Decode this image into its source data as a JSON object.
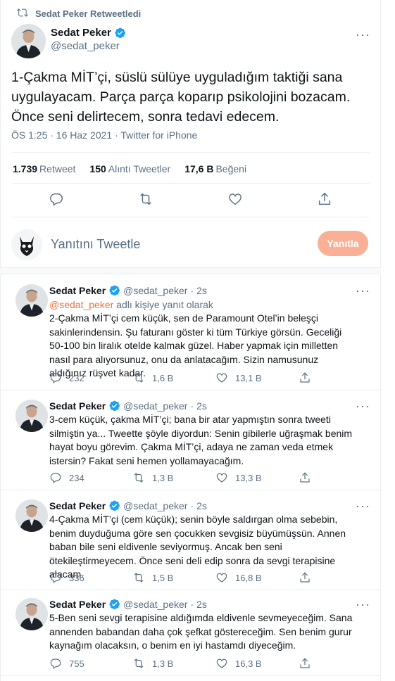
{
  "retweet_label": "Sedat Peker Retweetledi",
  "colors": {
    "accent": "#f4703a",
    "reply_button": "#f9b095",
    "muted": "#5b7083"
  },
  "main_tweet": {
    "name": "Sedat Peker",
    "handle": "@sedat_peker",
    "text": "1-Çakma MİT’çi, süslü sülüye uyguladığım taktiği sana uygulayacam. Parça parça koparıp psikolojini bozacam. Önce seni delirtecem, sonra tedavi edecem.",
    "time": "ÖS 1:25 · 16 Haz 2021 · ",
    "source": "Twitter for iPhone",
    "stats": [
      {
        "num": "1.739",
        "label": "Retweet"
      },
      {
        "num": "150",
        "label": "Alıntı Tweetler"
      },
      {
        "num": "17,6 B",
        "label": "Beğeni"
      }
    ]
  },
  "reply_box": {
    "placeholder": "Yanıtını Tweetle",
    "button": "Yanıtla"
  },
  "replies": [
    {
      "name": "Sedat Peker",
      "handle": "@sedat_peker",
      "dot": "·",
      "time": "2s",
      "reply_mention": "@sedat_peker",
      "reply_suffix": " adlı kişiye yanıt olarak",
      "text": "2-Çakma MİT’çi cem küçük, sen de Paramount Otel’in beleşçi sakinlerindensin.  Şu faturanı göster ki tüm Türkiye görsün. Geceliği 50-100 bin liralık otelde kalmak güzel. Haber yapmak için milletten nasıl para alıyorsunuz, onu da anlatacağım. Sizin namusunuz aldığınız rüşvet kadar.",
      "replies": "232",
      "retweets": "1,6 B",
      "likes": "13,1 B"
    },
    {
      "name": "Sedat Peker",
      "handle": "@sedat_peker",
      "dot": "·",
      "time": "2s",
      "text": "3-cem küçük, çakma MİT’çi; bana bir atar yapmıştın sonra tweeti silmiştin ya... Tweette şöyle diyordun: Senin gibilerle uğraşmak benim hayat boyu görevim. Çakma MİT’çi, adaya ne zaman veda etmek istersin? Fakat seni hemen yollamayacağım.",
      "replies": "234",
      "retweets": "1,3 B",
      "likes": "13,3 B"
    },
    {
      "name": "Sedat Peker",
      "handle": "@sedat_peker",
      "dot": "·",
      "time": "2s",
      "text": "4-Çakma MİT’çi (cem küçük); senin böyle saldırgan olma sebebin, benim duyduğuma göre sen çocukken sevgisiz büyümüşsün. Annen baban bile seni eldivenle seviyormuş. Ancak ben seni ötekileştirmeyecem. Önce seni deli edip sonra da sevgi terapisine alacam.",
      "replies": "336",
      "retweets": "1,5 B",
      "likes": "16,8 B"
    },
    {
      "name": "Sedat Peker",
      "handle": "@sedat_peker",
      "dot": "·",
      "time": "2s",
      "text": "5-Ben seni sevgi terapisine aldığımda eldivenle sevmeyeceğim. Sana annenden babandan daha çok şefkat göstereceğim. Sen benim gurur kaynağım olacaksın, o benim en iyi hastamdı diyeceğim.",
      "replies": "755",
      "retweets": "1,3 B",
      "likes": "16,3 B"
    }
  ]
}
